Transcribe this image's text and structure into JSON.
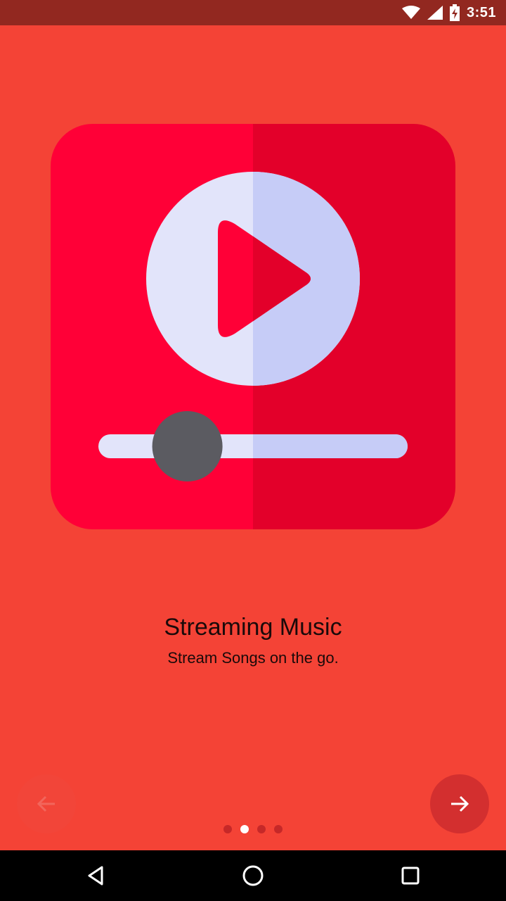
{
  "status_bar": {
    "time": "3:51",
    "icons": [
      "wifi-icon",
      "cell-signal-icon",
      "battery-charging-icon"
    ]
  },
  "slide": {
    "title": "Streaming Music",
    "subtitle": "Stream Songs on the go.",
    "illustration": "music-player-illustration",
    "slider_progress": 0.27
  },
  "pager": {
    "page_count": 4,
    "current_page": 2
  },
  "buttons": {
    "prev_icon": "arrow-left-icon",
    "next_icon": "arrow-right-icon"
  },
  "system_nav": {
    "icons": [
      "back-icon",
      "home-icon",
      "recents-icon"
    ]
  },
  "colors": {
    "background": "#F44336",
    "status_bar": "#922820",
    "card_left": "#FF0037",
    "card_right": "#E3002A",
    "disc_left": "#E2E4FA",
    "disc_right": "#C6CCF7",
    "knob": "#5B5B61"
  }
}
